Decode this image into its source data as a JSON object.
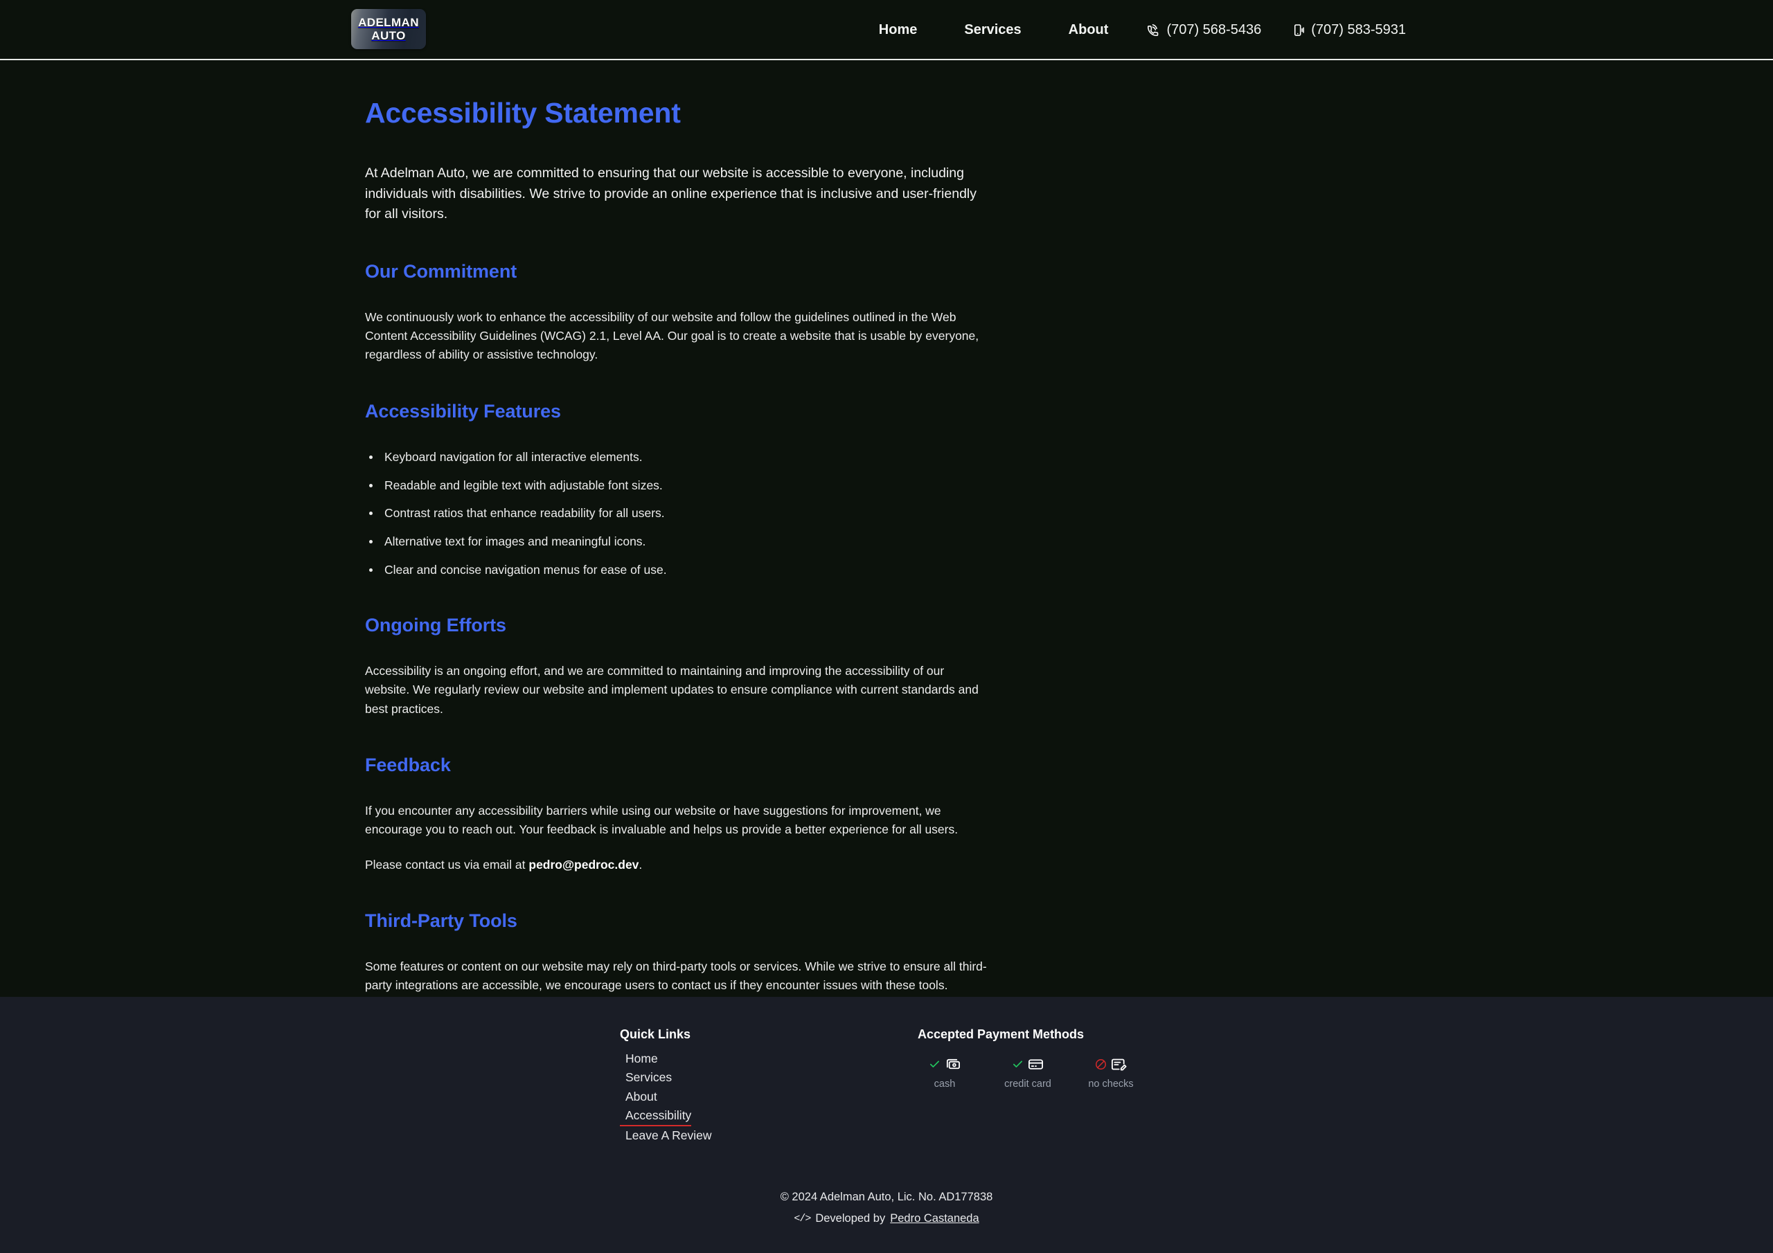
{
  "colors": {
    "page_bg": "#0c120c",
    "footer_bg": "#1a1d26",
    "heading_blue": "#4269f2",
    "body_text": "#ececec",
    "accent_red": "#d42a2a",
    "check_green": "#22c55e",
    "muted_label": "#9aa1ad"
  },
  "header": {
    "logo": {
      "line1": "ADELMAN",
      "line2": "AUTO"
    },
    "nav": [
      {
        "label": "Home",
        "type": "link"
      },
      {
        "label": "Services",
        "type": "link"
      },
      {
        "label": "About",
        "type": "link"
      }
    ],
    "phones": [
      {
        "icon": "phone-call-icon",
        "number": "(707) 568-5436"
      },
      {
        "icon": "mobile-vibrate-icon",
        "number": "(707) 583-5931"
      }
    ]
  },
  "main": {
    "title": "Accessibility Statement",
    "intro": "At Adelman Auto, we are committed to ensuring that our website is accessible to everyone, including individuals with disabilities. We strive to provide an online experience that is inclusive and user-friendly for all visitors.",
    "sections": [
      {
        "heading": "Our Commitment",
        "body": "We continuously work to enhance the accessibility of our website and follow the guidelines outlined in the Web Content Accessibility Guidelines (WCAG) 2.1, Level AA. Our goal is to create a website that is usable by everyone, regardless of ability or assistive technology."
      },
      {
        "heading": "Accessibility Features",
        "items": [
          "Keyboard navigation for all interactive elements.",
          "Readable and legible text with adjustable font sizes.",
          "Contrast ratios that enhance readability for all users.",
          "Alternative text for images and meaningful icons.",
          "Clear and concise navigation menus for ease of use."
        ]
      },
      {
        "heading": "Ongoing Efforts",
        "body": "Accessibility is an ongoing effort, and we are committed to maintaining and improving the accessibility of our website. We regularly review our website and implement updates to ensure compliance with current standards and best practices."
      },
      {
        "heading": "Feedback",
        "body": "If you encounter any accessibility barriers while using our website or have suggestions for improvement, we encourage you to reach out. Your feedback is invaluable and helps us provide a better experience for all users.",
        "contact_prefix": "Please contact us via email at ",
        "contact_email": "pedro@pedroc.dev",
        "contact_suffix": "."
      },
      {
        "heading": "Third-Party Tools",
        "body": "Some features or content on our website may rely on third-party tools or services. While we strive to ensure all third-party integrations are accessible, we encourage users to contact us if they encounter issues with these tools."
      }
    ]
  },
  "footer": {
    "quick_links_heading": "Quick Links",
    "quick_links": [
      {
        "label": "Home",
        "active": false
      },
      {
        "label": "Services",
        "active": false
      },
      {
        "label": "About",
        "active": false
      },
      {
        "label": "Accessibility",
        "active": true
      },
      {
        "label": "Leave A Review",
        "active": false
      }
    ],
    "payment_heading": "Accepted Payment Methods",
    "payment_methods": [
      {
        "label": "cash",
        "status": "accepted",
        "icon": "banknotes-icon"
      },
      {
        "label": "credit card",
        "status": "accepted",
        "icon": "credit-card-icon"
      },
      {
        "label": "no checks",
        "status": "declined",
        "icon": "check-document-icon"
      }
    ],
    "copyright": "© 2024 Adelman Auto, Lic. No. AD177838",
    "developed_prefix": "Developed by",
    "developer": "Pedro Castaneda"
  }
}
